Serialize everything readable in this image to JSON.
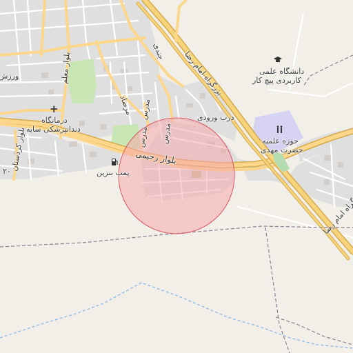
{
  "map": {
    "labels": {
      "rahimi_blvd": "بلوار رحیمی",
      "emam_reza_hwy_upper": "بزرگراه امام رضا",
      "emam_reza_hwy_lower": "بزرگراه امام رضا",
      "modarres_1": "مدرس",
      "modarres_2": "مدرس",
      "modarres_3": "مدرس",
      "jandi": "جندی",
      "morsad": "مرصاد",
      "moallem_blvd": "بلوار معلم",
      "kordestan_blvd": "بلوار کردستان",
      "varzesh": "ورزش",
      "dentist_line1": "درمانگاه",
      "dentist_line2": "دندانپزشکی سایه",
      "gas_station": "پمپ بنزین",
      "university_line1": "دانشگاه علمی",
      "university_line2": "کاربردی پیچ کار",
      "entrance_gate": "درب ورودی",
      "seminary_line1": "حوزه علمیه",
      "seminary_line2": "حضرت مهدی",
      "road_number": "۲۰"
    },
    "icons": [
      "hospital-icon",
      "fuel-icon",
      "university-icon",
      "place-of-worship-icon"
    ],
    "colors": {
      "land": "#f2efe9",
      "residential": "#e0dfdf",
      "highway": "#f7d47c",
      "highway_casing": "#d4a94a",
      "primary_road": "#fcd68a",
      "minor_road": "#ffffff",
      "park": "#c8e6b4",
      "worship_area": "#d6d2f2",
      "admin_boundary": "#8a7f90",
      "water": "#8ab8e8",
      "highlight_fill": "#f4a8ab",
      "highlight_stroke": "#d85a62"
    }
  }
}
